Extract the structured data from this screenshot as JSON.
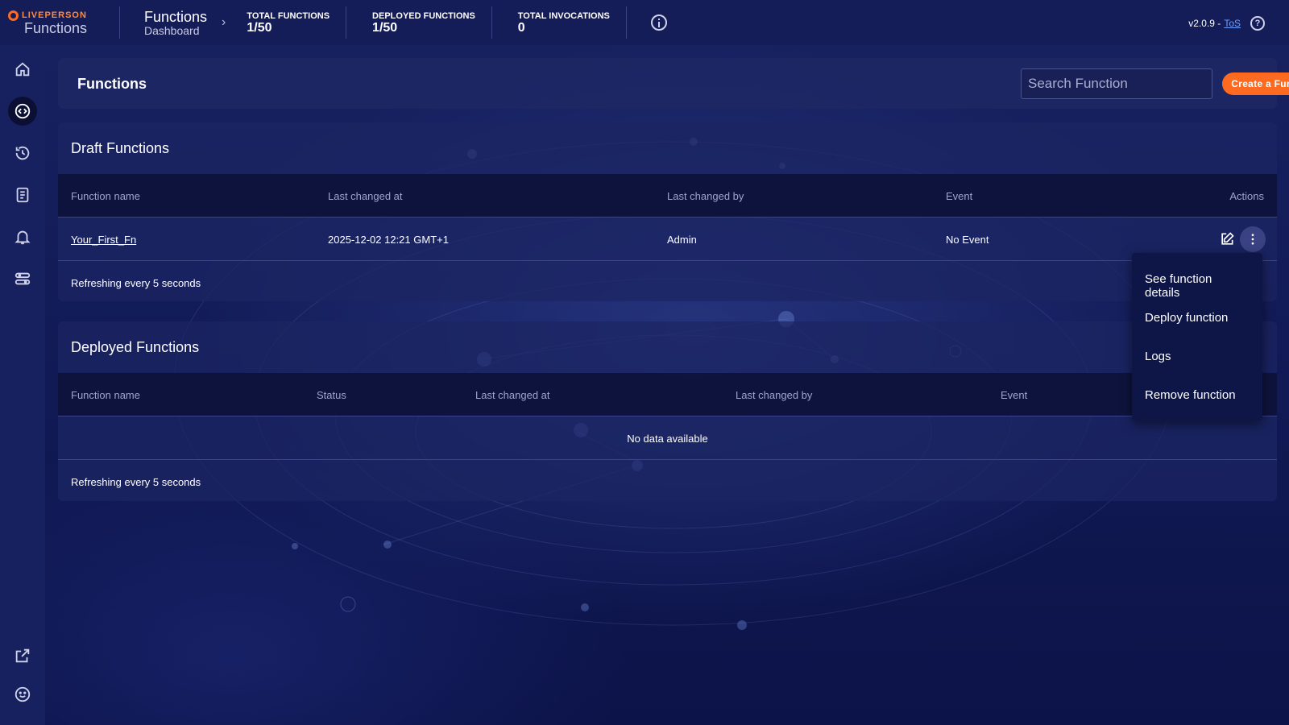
{
  "app": {
    "brand": "LIVEPERSON",
    "product": "Functions",
    "version": "v2.0.9 -",
    "tos": "ToS"
  },
  "breadcrumb": {
    "title": "Functions",
    "subtitle": "Dashboard"
  },
  "stats": [
    {
      "label": "TOTAL FUNCTIONS",
      "value": "1/50"
    },
    {
      "label": "DEPLOYED FUNCTIONS",
      "value": "1/50"
    },
    {
      "label": "TOTAL INVOCATIONS",
      "value": "0"
    }
  ],
  "sidebar": {
    "items": [
      {
        "icon": "home-icon"
      },
      {
        "icon": "functions-icon",
        "active": true
      },
      {
        "icon": "history-icon"
      },
      {
        "icon": "document-icon"
      },
      {
        "icon": "bell-icon"
      },
      {
        "icon": "settings-icon"
      },
      {
        "icon": "external-link-icon"
      },
      {
        "icon": "smiley-icon"
      }
    ]
  },
  "header": {
    "title": "Functions",
    "search_placeholder": "Search Function",
    "create_label": "Create a Function"
  },
  "draft": {
    "title": "Draft Functions",
    "columns": [
      "Function name",
      "Last changed at",
      "Last changed by",
      "Event",
      "Actions"
    ],
    "rows": [
      {
        "name": "Your_First_Fn",
        "changed_at": "2025-12-02 12:21 GMT+1",
        "changed_by": "Admin",
        "event": "No Event"
      }
    ],
    "footer": "Refreshing every 5 seconds"
  },
  "deployed": {
    "title": "Deployed Functions",
    "columns": [
      "Function name",
      "Status",
      "Last changed at",
      "Last changed by",
      "Event"
    ],
    "empty": "No data available",
    "footer": "Refreshing every 5 seconds"
  },
  "menu": {
    "items": [
      "See function details",
      "Deploy function",
      "Logs",
      "Remove function"
    ]
  },
  "colors": {
    "accent": "#ff6a21",
    "background": "#0b1340",
    "link": "#6fa0ff"
  }
}
